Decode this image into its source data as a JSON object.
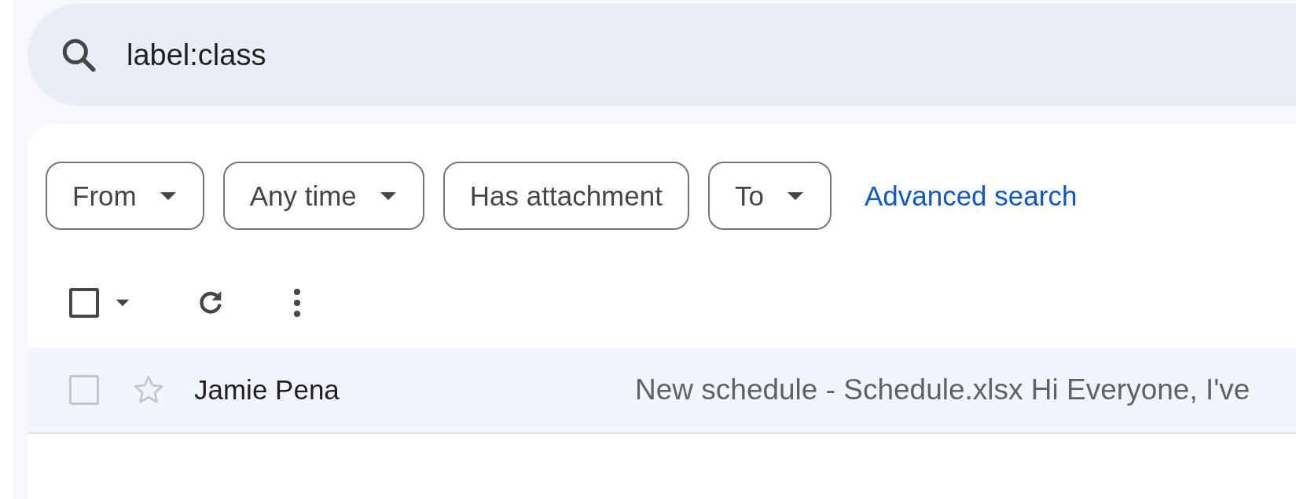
{
  "search": {
    "value": "label:class"
  },
  "filters": [
    {
      "label": "From",
      "kind": "dropdown"
    },
    {
      "label": "Any time",
      "kind": "dropdown"
    },
    {
      "label": "Has attachment",
      "kind": "toggle"
    },
    {
      "label": "To",
      "kind": "dropdown"
    }
  ],
  "advanced_search": "Advanced search",
  "toolbar": {
    "select_all_checked": false
  },
  "messages": [
    {
      "sender": "Jamie Pena",
      "snippet": "New schedule - Schedule.xlsx Hi Everyone, I've",
      "checked": false,
      "starred": false
    }
  ]
}
